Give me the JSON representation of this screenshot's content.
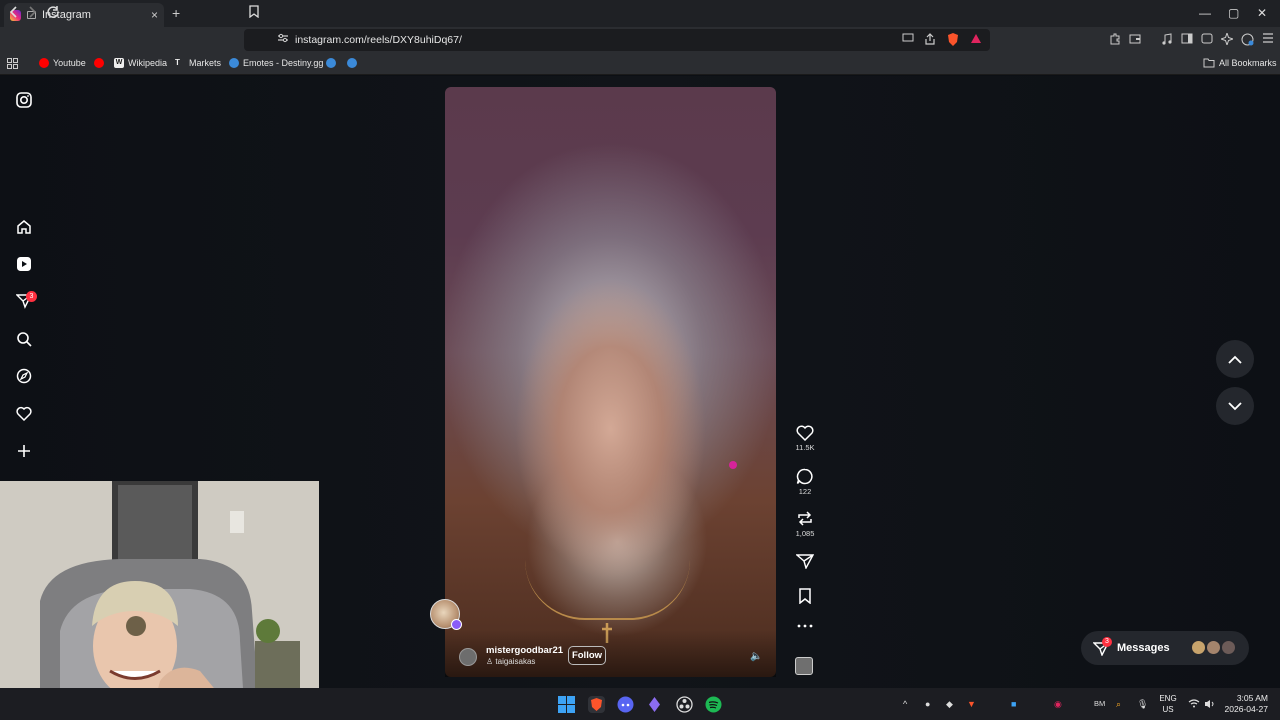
{
  "browser": {
    "tab_title": "Instagram",
    "tab_close": "×",
    "new_tab": "+",
    "window_controls": {
      "minimize": "—",
      "maximize": "▢",
      "close": "✕"
    },
    "url": "instagram.com/reels/DXY8uhiDq67/",
    "bookmarks": [
      {
        "label": "Youtube",
        "color": "#ff0000"
      },
      {
        "label": "",
        "color": "#ff0000"
      },
      {
        "label": "Wikipedia",
        "color": "#ffffff"
      },
      {
        "label": "Markets",
        "color": "#ffffff"
      },
      {
        "label": "Emotes - Destiny.gg",
        "color": "#3b8ad9"
      },
      {
        "label": "",
        "color": "#3b8ad9"
      },
      {
        "label": "",
        "color": "#3b8ad9"
      }
    ],
    "all_bookmarks": "All Bookmarks"
  },
  "sidebar": {
    "notifications_badge": "3",
    "icons": [
      "instagram-logo-icon",
      "home-icon",
      "reels-icon",
      "direct-icon",
      "search-icon",
      "explore-icon",
      "heart-icon",
      "create-icon"
    ]
  },
  "reel": {
    "username": "mistergoodbar21",
    "audio": "taigaisakas",
    "follow_label": "Follow",
    "mute_icon": "🔈",
    "likes": "11.5K",
    "comments": "122",
    "reposts": "1,085"
  },
  "messages": {
    "label": "Messages",
    "badge": "3"
  },
  "taskbar": {
    "lang_top": "ENG",
    "lang_bottom": "US",
    "time": "3:05 AM",
    "date": "2026-04-27",
    "tray_glyphs": [
      "^",
      "●",
      "◆",
      "▼",
      "■",
      "◉",
      "BM",
      "⌕",
      "🎙"
    ]
  },
  "colors": {
    "accent_red": "#ff3040",
    "page_bg": "#0c0f14"
  }
}
